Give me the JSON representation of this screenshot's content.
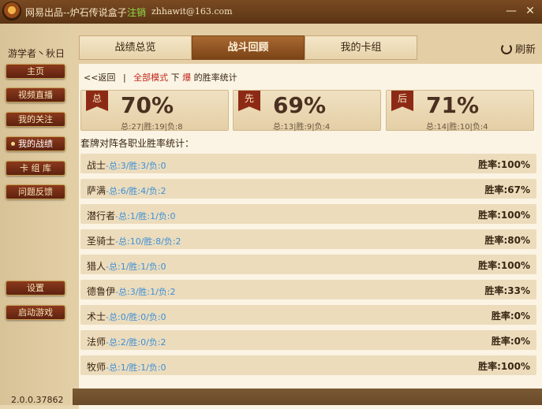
{
  "titlebar": {
    "app_title": "网易出品--炉石传说盒子",
    "logout": "注销",
    "email": "zhhawit@163.com",
    "minimize_glyph": "—",
    "close_glyph": "✕"
  },
  "sidebar": {
    "username": "游学者丶秋日",
    "items": [
      {
        "label": "主页"
      },
      {
        "label": "视频直播"
      },
      {
        "label": "我的关注"
      },
      {
        "label": "我的战绩"
      },
      {
        "label": "卡 组 库"
      },
      {
        "label": "问题反馈"
      }
    ],
    "settings": "设置",
    "launch": "启动游戏",
    "version": "2.0.0.37862"
  },
  "tabs": [
    {
      "label": "战绩总览"
    },
    {
      "label": "战斗回顾"
    },
    {
      "label": "我的卡组"
    }
  ],
  "refresh_label": "刷新",
  "breadcrumb": {
    "back": "<<返回",
    "separator": "|",
    "mode": "全部模式",
    "text_mid": "下",
    "text_red": "爆",
    "text_end": "的胜率统计"
  },
  "stats": [
    {
      "flag": "总",
      "pct": "70%",
      "sub": "总:27|胜:19|负:8"
    },
    {
      "flag": "先",
      "pct": "69%",
      "sub": "总:13|胜:9|负:4"
    },
    {
      "flag": "后",
      "pct": "71%",
      "sub": "总:14|胜:10|负:4"
    }
  ],
  "section_title": "套牌对阵各职业胜率统计：",
  "rows": [
    {
      "cls": "战士",
      "detail": "-总:3/胜:3/负:0",
      "rate": "胜率:100%"
    },
    {
      "cls": "萨满",
      "detail": "-总:6/胜:4/负:2",
      "rate": "胜率:67%"
    },
    {
      "cls": "潜行者",
      "detail": "-总:1/胜:1/负:0",
      "rate": "胜率:100%"
    },
    {
      "cls": "圣骑士",
      "detail": "-总:10/胜:8/负:2",
      "rate": "胜率:80%"
    },
    {
      "cls": "猎人",
      "detail": "-总:1/胜:1/负:0",
      "rate": "胜率:100%"
    },
    {
      "cls": "德鲁伊",
      "detail": "-总:3/胜:1/负:2",
      "rate": "胜率:33%"
    },
    {
      "cls": "术士",
      "detail": "-总:0/胜:0/负:0",
      "rate": "胜率:0%"
    },
    {
      "cls": "法师",
      "detail": "-总:2/胜:0/负:2",
      "rate": "胜率:0%"
    },
    {
      "cls": "牧师",
      "detail": "-总:1/胜:1/负:0",
      "rate": "胜率:100%"
    }
  ]
}
